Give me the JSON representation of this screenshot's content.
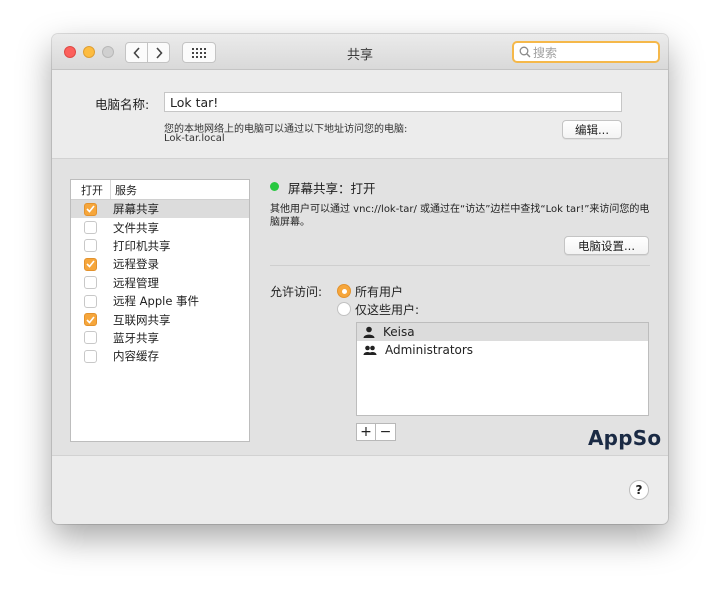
{
  "window": {
    "title": "共享"
  },
  "search": {
    "placeholder": "搜索"
  },
  "computer_name": {
    "label": "电脑名称:",
    "value": "Lok tar!",
    "address_desc": "您的本地网络上的电脑可以通过以下地址访问您的电脑:",
    "hostname": "Lok-tar.local",
    "edit_label": "编辑..."
  },
  "services": {
    "col_on": "打开",
    "col_service": "服务",
    "items": [
      {
        "label": "屏幕共享",
        "checked": true,
        "selected": true
      },
      {
        "label": "文件共享",
        "checked": false,
        "selected": false
      },
      {
        "label": "打印机共享",
        "checked": false,
        "selected": false
      },
      {
        "label": "远程登录",
        "checked": true,
        "selected": false
      },
      {
        "label": "远程管理",
        "checked": false,
        "selected": false
      },
      {
        "label": "远程 Apple 事件",
        "checked": false,
        "selected": false
      },
      {
        "label": "互联网共享",
        "checked": true,
        "selected": false
      },
      {
        "label": "蓝牙共享",
        "checked": false,
        "selected": false
      },
      {
        "label": "内容缓存",
        "checked": false,
        "selected": false
      }
    ]
  },
  "detail": {
    "status": "屏幕共享：打开",
    "status_color": "#28c840",
    "description": "其他用户可以通过 vnc://lok-tar/ 或通过在“访达”边栏中查找“Lok tar!”来访问您的电脑屏幕。",
    "computer_settings_label": "电脑设置...",
    "access_label": "允许访问:",
    "option_all": "所有用户",
    "option_only": "仅这些用户:",
    "selected_option": "all",
    "users": [
      {
        "name": "Keisa",
        "icon": "user-icon"
      },
      {
        "name": "Administrators",
        "icon": "group-icon"
      }
    ],
    "add_label": "+",
    "remove_label": "−"
  },
  "watermark": "AppSo",
  "help_label": "?",
  "colors": {
    "accent": "#f6a63b",
    "search_focus": "#f5b84a"
  }
}
